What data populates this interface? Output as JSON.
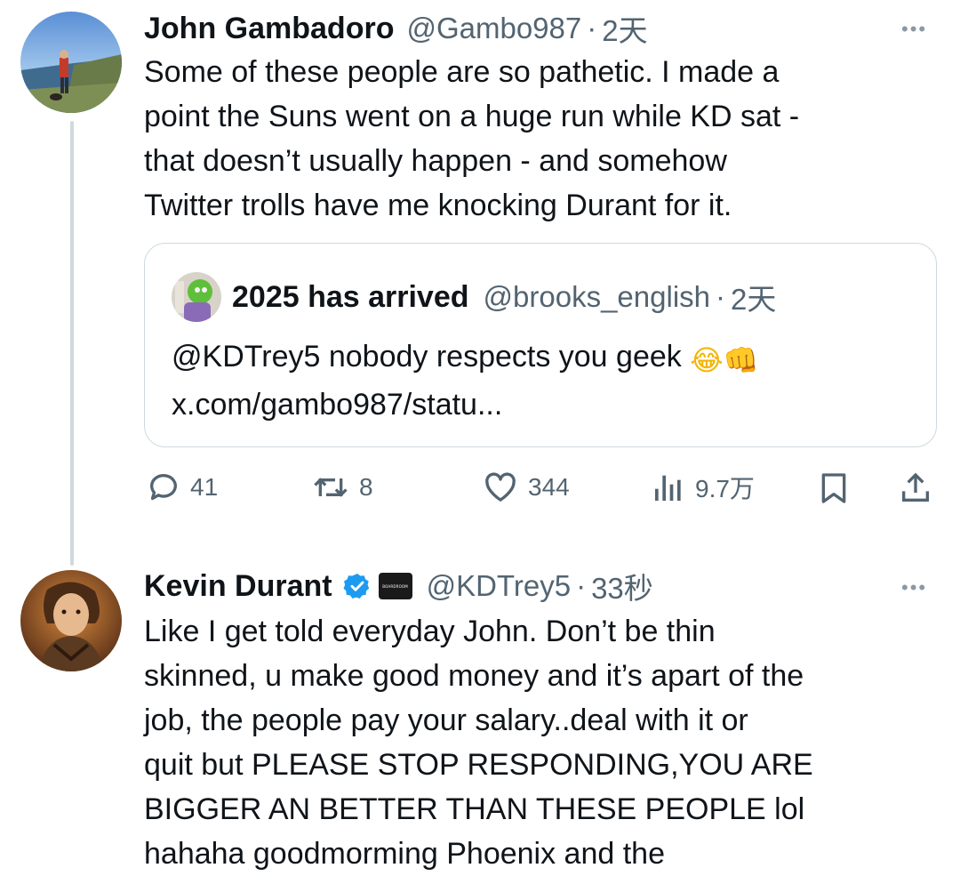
{
  "tweet1": {
    "name": "John Gambadoro",
    "handle": "@Gambo987",
    "separator": "·",
    "time": "2天",
    "more": "•••",
    "lines": [
      "Some of these people are so pathetic. I made a",
      "point the Suns went on a huge run while KD sat -",
      "that doesn’t usually happen - and somehow",
      "Twitter trolls have me knocking Durant for it."
    ]
  },
  "quote": {
    "name": "2025 has arrived",
    "handle": "@brooks_english",
    "separator": "·",
    "time": "2天",
    "text_line1": "@KDTrey5 nobody respects you geek",
    "emoji1": "😂",
    "emoji2": "👊",
    "text_line2": "x.com/gambo987/statu..."
  },
  "actions": {
    "replies": "41",
    "reposts": "8",
    "likes": "344",
    "views": "9.7万"
  },
  "tweet2": {
    "name": "Kevin Durant",
    "badge_text": "BOARDROOM",
    "handle": "@KDTrey5",
    "separator": "·",
    "time": "33秒",
    "more": "•••",
    "lines": [
      "Like I get told everyday John. Don’t be thin",
      "skinned, u make good money and it’s apart of the",
      "job, the people pay your salary..deal with it or",
      "quit but PLEASE STOP RESPONDING,YOU ARE",
      "BIGGER AN BETTER THAN THESE PEOPLE lol",
      "hahaha goodmorming Phoenix and the"
    ]
  },
  "colors": {
    "text": "#0f1419",
    "secondary": "#536471",
    "verified": "#1d9bf0",
    "border": "#cfd9de"
  },
  "icons": [
    "reply-icon",
    "repost-icon",
    "like-icon",
    "views-icon",
    "bookmark-icon",
    "share-icon",
    "verified-badge-icon",
    "more-icon"
  ]
}
